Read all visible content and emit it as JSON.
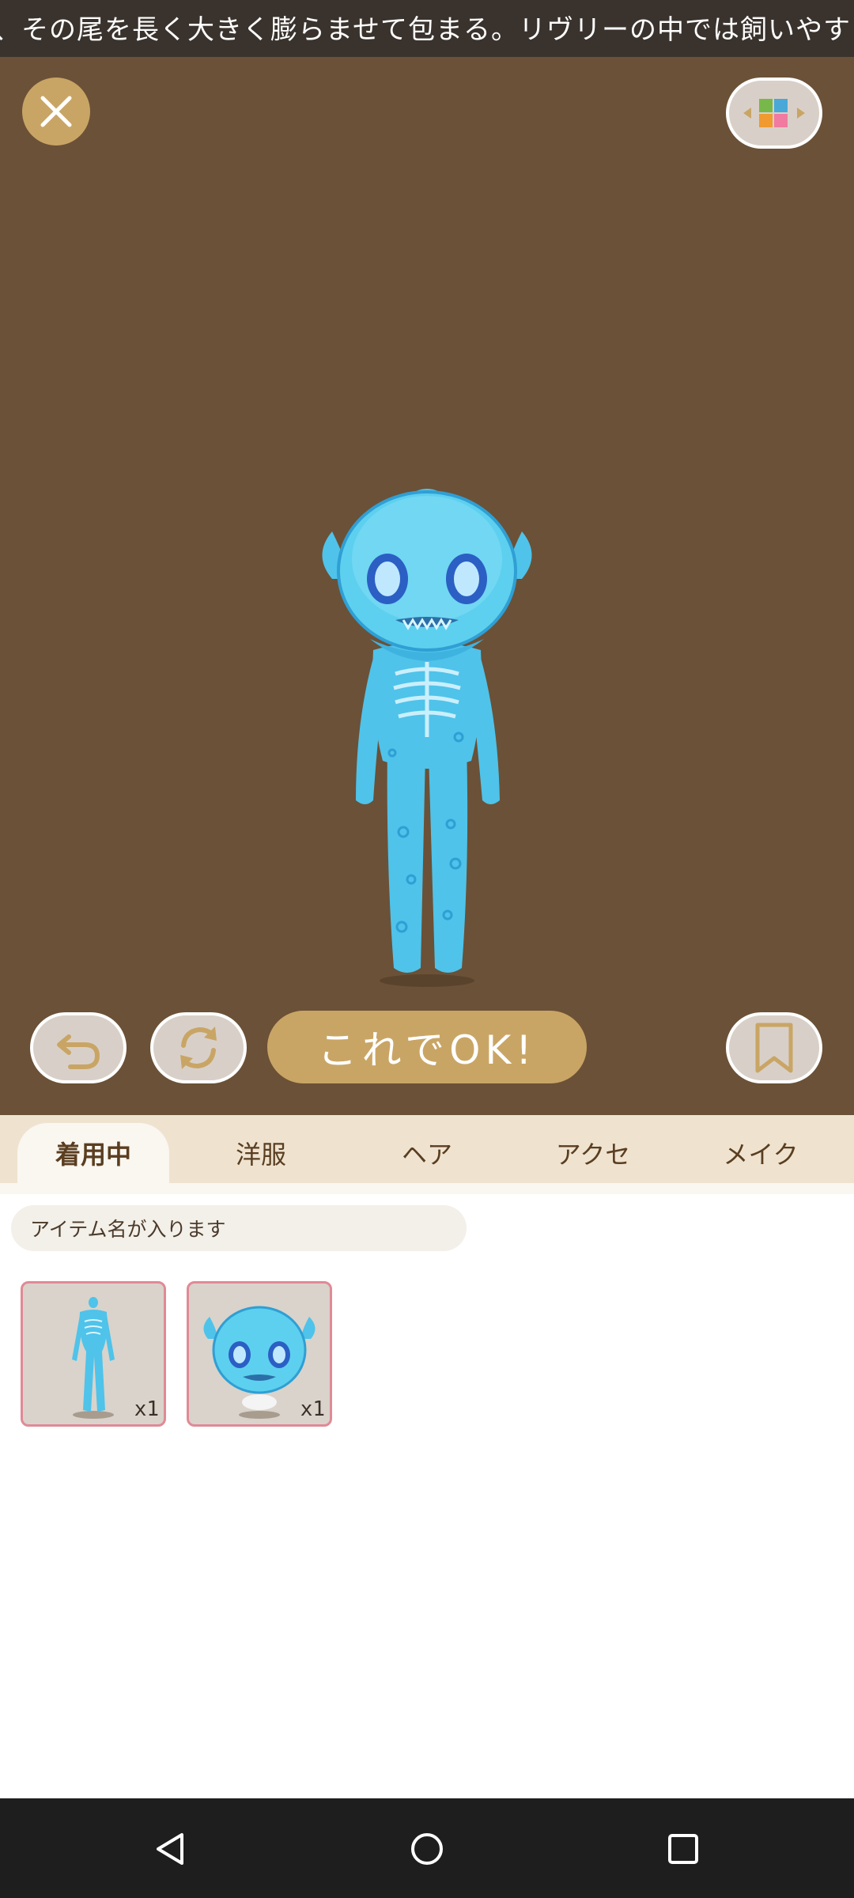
{
  "ticker": {
    "text": "、その尾を長く大きく膨らませて包まる。リヴリーの中では飼いやすい"
  },
  "stage": {
    "ok_label": "これでOK!",
    "bg_color": "#6b5137",
    "accent_color": "#c9a565"
  },
  "tabs": [
    {
      "label": "着用中",
      "active": true
    },
    {
      "label": "洋服",
      "active": false
    },
    {
      "label": "ヘア",
      "active": false
    },
    {
      "label": "アクセ",
      "active": false
    },
    {
      "label": "メイク",
      "active": false
    }
  ],
  "item_name": {
    "placeholder": "アイテム名が入ります"
  },
  "items": [
    {
      "type": "body-outfit",
      "qty": "x1"
    },
    {
      "type": "head-outfit",
      "qty": "x1"
    }
  ],
  "icons": {
    "close": "close-icon",
    "palette": "palette-icon",
    "undo": "undo-icon",
    "refresh": "refresh-icon",
    "bookmark": "bookmark-icon",
    "back": "back-icon",
    "home": "home-icon",
    "recents": "recents-icon"
  }
}
